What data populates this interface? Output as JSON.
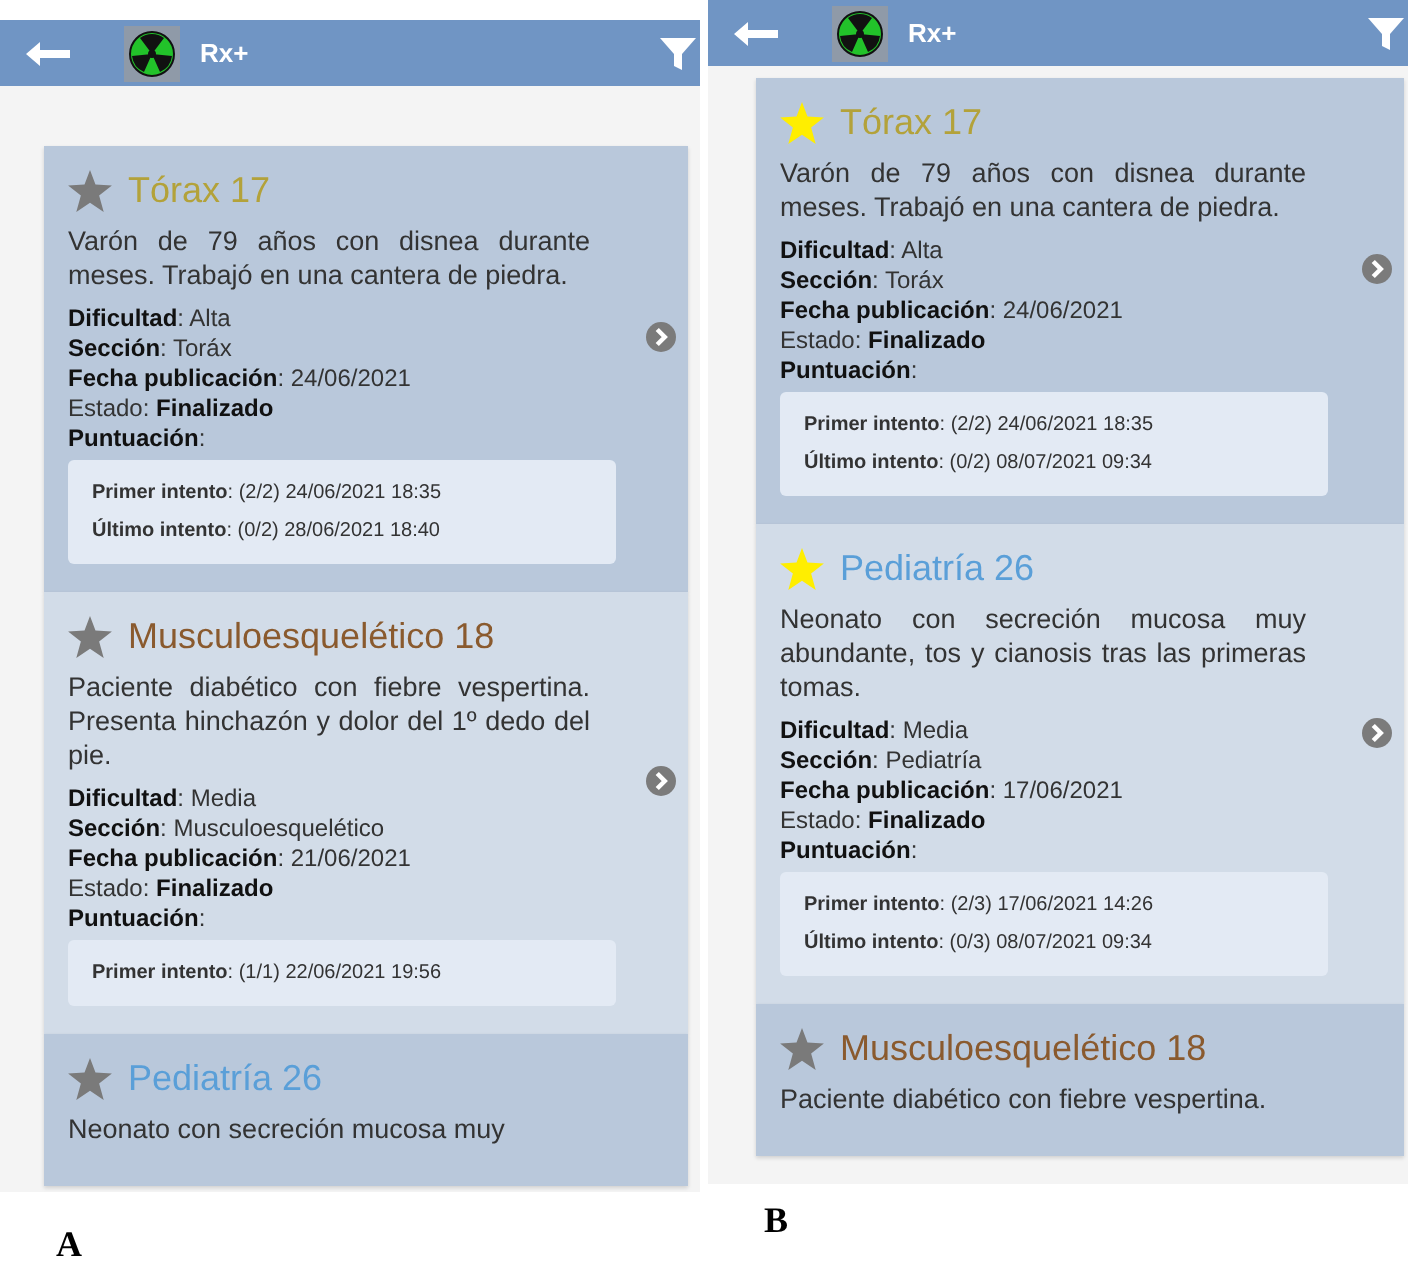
{
  "panels": [
    {
      "label": "A",
      "app_bar": {
        "title": "Rx+"
      },
      "cases": [
        {
          "title": "Tórax 17",
          "color": "#b3a23a",
          "favorite": false,
          "description": "Varón de 79 años con disnea durante meses. Trabajó en una cantera de piedra.",
          "fields": [
            "**Dificultad**: Alta",
            "**Sección**: Toráx",
            "**Fecha publicación**: 24/06/2021",
            "Estado: **Finalizado**",
            "**Puntuación**:"
          ],
          "attempts": [
            "**Primer intento**: (2/2) 24/06/2021 18:35",
            "**Último intento**: (0/2) 28/06/2021 18:40"
          ]
        },
        {
          "title": "Musculoesquelético 18",
          "color": "#8a5a2e",
          "favorite": false,
          "description": "Paciente diabético con fiebre vespertina. Presenta hinchazón y dolor del 1º dedo del pie.",
          "fields": [
            "**Dificultad**: Media",
            "**Sección**: Musculoesquelético",
            "**Fecha publicación**: 21/06/2021",
            "Estado: **Finalizado**",
            "**Puntuación**:"
          ],
          "attempts": [
            "**Primer intento**: (1/1) 22/06/2021 19:56"
          ]
        },
        {
          "title": "Pediatría 26",
          "color": "#5a9fd8",
          "favorite": false,
          "description": "Neonato con secreción mucosa muy"
        }
      ]
    },
    {
      "label": "B",
      "app_bar": {
        "title": "Rx+"
      },
      "cases": [
        {
          "title": "Tórax 17",
          "color": "#b3a23a",
          "favorite": true,
          "description": "Varón de 79 años con disnea durante meses. Trabajó en una cantera de piedra.",
          "fields": [
            "**Dificultad**: Alta",
            "**Sección**: Toráx",
            "**Fecha publicación**: 24/06/2021",
            "Estado: **Finalizado**",
            "**Puntuación**:"
          ],
          "attempts": [
            "**Primer intento**: (2/2) 24/06/2021 18:35",
            "**Último intento**: (0/2) 08/07/2021 09:34"
          ]
        },
        {
          "title": "Pediatría 26",
          "color": "#5a9fd8",
          "favorite": true,
          "description": "Neonato con secreción mucosa muy abundante, tos y cianosis tras las primeras tomas.",
          "fields": [
            "**Dificultad**: Media",
            "**Sección**: Pediatría",
            "**Fecha publicación**: 17/06/2021",
            "Estado: **Finalizado**",
            "**Puntuación**:"
          ],
          "attempts": [
            "**Primer intento**: (2/3) 17/06/2021 14:26",
            "**Último intento**: (0/3) 08/07/2021 09:34"
          ]
        },
        {
          "title": "Musculoesquelético 18",
          "color": "#8a5a2e",
          "favorite": false,
          "description": "Paciente diabético con fiebre vespertina."
        }
      ]
    }
  ]
}
